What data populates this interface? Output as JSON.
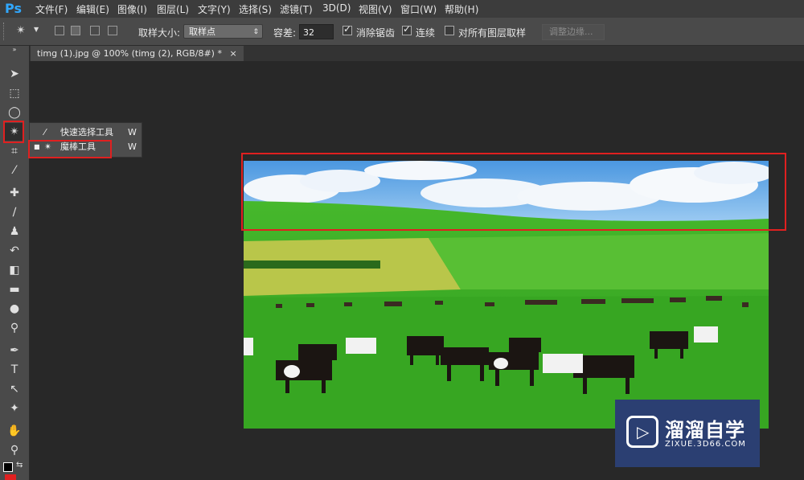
{
  "app": {
    "logo": "Ps"
  },
  "menu": [
    "文件(F)",
    "编辑(E)",
    "图像(I)",
    "图层(L)",
    "文字(Y)",
    "选择(S)",
    "滤镜(T)",
    "3D(D)",
    "视图(V)",
    "窗口(W)",
    "帮助(H)"
  ],
  "options": {
    "sample_size_label": "取样大小:",
    "sample_size_value": "取样点",
    "tolerance_label": "容差:",
    "tolerance_value": "32",
    "antialias_label": "消除锯齿",
    "antialias_checked": true,
    "contiguous_label": "连续",
    "contiguous_checked": true,
    "all_layers_label": "对所有图层取样",
    "all_layers_checked": false,
    "refine_edge_label": "调整边缘..."
  },
  "document": {
    "tab_title": "timg (1).jpg @ 100% (timg (2), RGB/8#) *",
    "close_glyph": "×"
  },
  "flyout": [
    {
      "label": "快速选择工具",
      "shortcut": "W",
      "icon": "quick-selection-icon"
    },
    {
      "label": "魔棒工具",
      "shortcut": "W",
      "icon": "magic-wand-icon",
      "active": true
    }
  ],
  "watermark": {
    "title": "溜溜自学",
    "subtitle": "ZIXUE.3D66.COM"
  },
  "colors": {
    "highlight": "#e02020",
    "accent": "#31a8ff"
  }
}
